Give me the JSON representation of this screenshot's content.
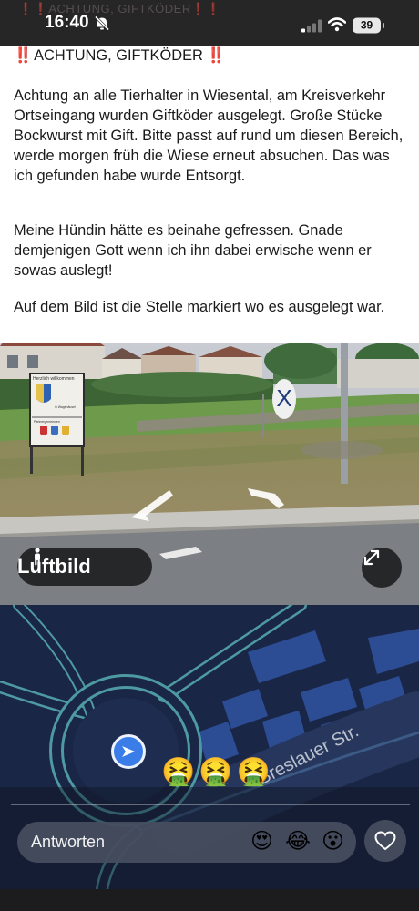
{
  "status_bar": {
    "ghost_text": "❗❗ACHTUNG, GIFTKÖDER❗❗",
    "time": "16:40",
    "battery": "39",
    "icons": [
      "bell-slash-icon",
      "signal-icon",
      "wifi-icon",
      "battery-icon"
    ]
  },
  "post": {
    "title_marks": "‼️",
    "title_text": "ACHTUNG, GIFTKÖDER",
    "title_marks_end": "‼️",
    "paragraphs": [
      "Achtung an alle Tierhalter in Wiesental, am Kreisverkehr Ortseingang wurden Giftköder ausgelegt. Große Stücke Bockwurst mit Gift. Bitte passt auf rund um diesen Bereich, werde morgen früh die Wiese erneut absuchen. Das was ich gefunden habe wurde Entsorgt.",
      "Meine Hündin hätte es beinahe gefressen. Gnade demjenigen Gott wenn ich ihn dabei erwische  wenn er sowas auslegt!",
      "Auf dem Bild ist die Stelle markiert wo es ausgelegt war."
    ]
  },
  "street_view": {
    "marker": "X",
    "luftbild_label": "Luftbild",
    "sign_lines": [
      "Herzlich willkommen",
      "in Wagshäusel",
      "Partnergemeinden"
    ]
  },
  "map": {
    "street_name": "Breslauer Str.",
    "post_reactions": "🤮🤮🤮"
  },
  "reply": {
    "placeholder": "Antworten",
    "quick_reactions": [
      "😍",
      "😂",
      "😮"
    ]
  },
  "colors": {
    "map_background": "#1a2646",
    "building": "#2c4c94",
    "road": "#4e9aa2",
    "nav_pin": "#3b7de8",
    "alert_red": "#e21a1a"
  }
}
